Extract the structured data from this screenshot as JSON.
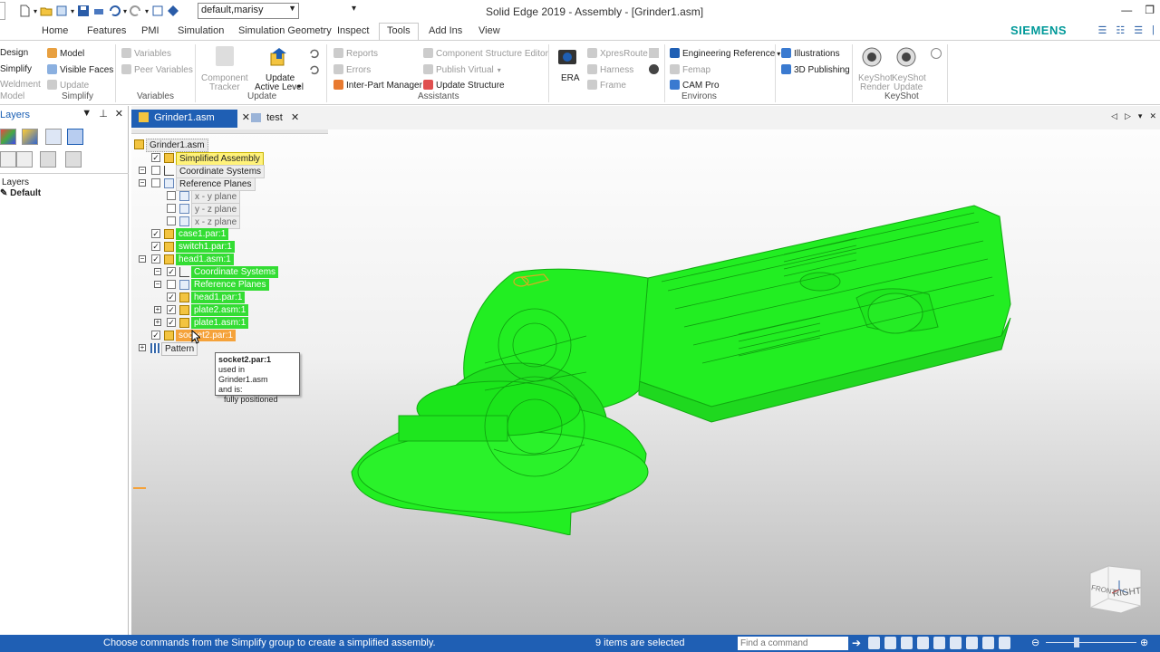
{
  "window": {
    "title": "Solid Edge 2019 - Assembly - [Grinder1.asm]",
    "doc_selector": "default,marisy",
    "brand": "SIEMENS"
  },
  "ribbon_tabs": [
    "Home",
    "Features",
    "PMI",
    "Simulation",
    "Simulation Geometry",
    "Inspect",
    "Tools",
    "Add Ins",
    "View"
  ],
  "active_tab": "Tools",
  "ribbon": {
    "simplify": {
      "design": "Design",
      "simplify": "Simplify",
      "weldment": "Weldment",
      "model_partial": "Model",
      "model": "Model",
      "visible_faces": "Visible Faces",
      "update": "Update",
      "label": "Simplify"
    },
    "variables": {
      "variables": "Variables",
      "peer_variables": "Peer Variables",
      "label": "Variables"
    },
    "update": {
      "component_tracker_1": "Component",
      "component_tracker_2": "Tracker",
      "update_active_1": "Update",
      "update_active_2": "Active Level",
      "label": "Update"
    },
    "assistants": {
      "reports": "Reports",
      "errors": "Errors",
      "inter_part": "Inter-Part Manager",
      "component_structure": "Component Structure Editor",
      "publish_virtual": "Publish Virtual",
      "update_structure": "Update Structure",
      "label": "Assistants"
    },
    "environs": {
      "era": "ERA",
      "xpresroute": "XpresRoute",
      "harness": "Harness",
      "frame": "Frame",
      "engineering_reference": "Engineering Reference",
      "femap": "Femap",
      "cam_pro": "CAM Pro",
      "label": "Environs"
    },
    "illustrations": {
      "illustrations": "Illustrations",
      "publishing": "3D Publishing"
    },
    "keyshot": {
      "render_1": "KeyShot",
      "render_2": "Render",
      "update_1": "KeyShot",
      "update_2": "Update",
      "label": "KeyShot"
    }
  },
  "left_panel": {
    "title": "Layers",
    "layers_header": "Layers",
    "default_layer": "Default"
  },
  "doc_tabs": [
    {
      "label": "Grinder1.asm",
      "active": true
    },
    {
      "label": "test",
      "active": false
    }
  ],
  "tree": {
    "root": "Grinder1.asm",
    "nodes": [
      {
        "label": "Simplified Assembly",
        "checked": true,
        "style": "yellow"
      },
      {
        "label": "Coordinate Systems",
        "checked": false,
        "style": "gray"
      },
      {
        "label": "Reference Planes",
        "checked": false,
        "style": "gray"
      },
      {
        "label": "x - y plane",
        "checked": false,
        "style": "gray"
      },
      {
        "label": "y - z plane",
        "checked": false,
        "style": "gray"
      },
      {
        "label": "x - z plane",
        "checked": false,
        "style": "gray"
      },
      {
        "label": "case1.par:1",
        "checked": true,
        "style": "green"
      },
      {
        "label": "switch1.par:1",
        "checked": true,
        "style": "green"
      },
      {
        "label": "head1.asm:1",
        "checked": true,
        "style": "green"
      },
      {
        "label": "Coordinate Systems",
        "checked": true,
        "style": "green"
      },
      {
        "label": "Reference Planes",
        "checked": false,
        "style": "green"
      },
      {
        "label": "head1.par:1",
        "checked": true,
        "style": "green"
      },
      {
        "label": "plate2.asm:1",
        "checked": true,
        "style": "green"
      },
      {
        "label": "plate1.asm:1",
        "checked": true,
        "style": "green"
      },
      {
        "label": "socket2.par:1",
        "checked": true,
        "style": "orange"
      },
      {
        "label": "Pattern",
        "checked": false,
        "style": "plain"
      }
    ]
  },
  "tooltip": {
    "title": "socket2.par:1",
    "line1": "used in Grinder1.asm",
    "line2": "and is:",
    "line3": "fully positioned"
  },
  "viewcube": {
    "front": "FRONT",
    "right": "RIGHT"
  },
  "status": {
    "message": "Choose commands from the Simplify group to create a simplified assembly.",
    "selection": "9 items are selected",
    "find_placeholder": "Find a command"
  },
  "colors": {
    "accent": "#1f5fb4",
    "model_green": "#22ee22",
    "highlight_green": "#33dd33",
    "highlight_orange": "#f5a23a",
    "highlight_yellow": "#fff27a"
  }
}
